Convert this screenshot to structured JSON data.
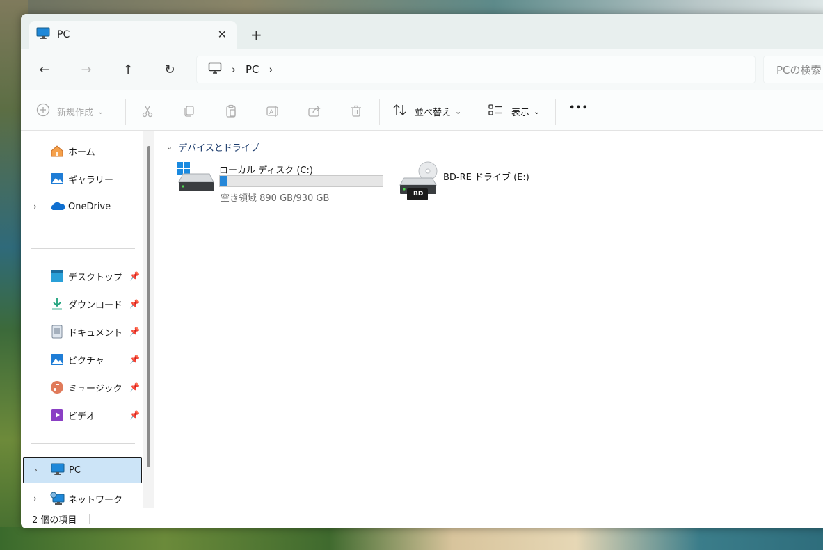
{
  "window": {
    "tab_title": "PC",
    "close_glyph": "✕",
    "newtab_glyph": "+"
  },
  "nav": {
    "back_glyph": "←",
    "forward_glyph": "→",
    "up_glyph": "↑",
    "refresh_glyph": "↻",
    "breadcrumb": [
      "PC"
    ],
    "separator": "›",
    "search_placeholder": "PCの検索"
  },
  "toolbar": {
    "new_label": "新規作成",
    "sort_label": "並べ替え",
    "view_label": "表示",
    "more_glyph": "•••",
    "dropdown_glyph": "⌄"
  },
  "sidebar": {
    "items_top": [
      {
        "label": "ホーム",
        "icon": "home-icon"
      },
      {
        "label": "ギャラリー",
        "icon": "gallery-icon"
      },
      {
        "label": "OneDrive",
        "icon": "onedrive-icon",
        "expandable": true
      }
    ],
    "pinned": [
      {
        "label": "デスクトップ",
        "icon": "desktop-icon"
      },
      {
        "label": "ダウンロード",
        "icon": "download-icon"
      },
      {
        "label": "ドキュメント",
        "icon": "documents-icon"
      },
      {
        "label": "ピクチャ",
        "icon": "pictures-icon"
      },
      {
        "label": "ミュージック",
        "icon": "music-icon"
      },
      {
        "label": "ビデオ",
        "icon": "videos-icon"
      }
    ],
    "items_bottom": [
      {
        "label": "PC",
        "icon": "pc-icon",
        "selected": true
      },
      {
        "label": "ネットワーク",
        "icon": "network-icon"
      }
    ],
    "pin_glyph": "📌",
    "chevron_glyph": "›"
  },
  "content": {
    "section_title": "デバイスとドライブ",
    "section_chevron": "⌄",
    "drives": [
      {
        "name": "ローカル ディスク (C:)",
        "space": "空き領域 890 GB/930 GB",
        "used_fraction": 0.043
      },
      {
        "name": "BD-RE ドライブ (E:)",
        "badge": "BD"
      }
    ]
  },
  "status": {
    "item_count": "2 個の項目"
  },
  "colors": {
    "accent": "#2687d8",
    "selected_bg": "#cce4f7"
  }
}
